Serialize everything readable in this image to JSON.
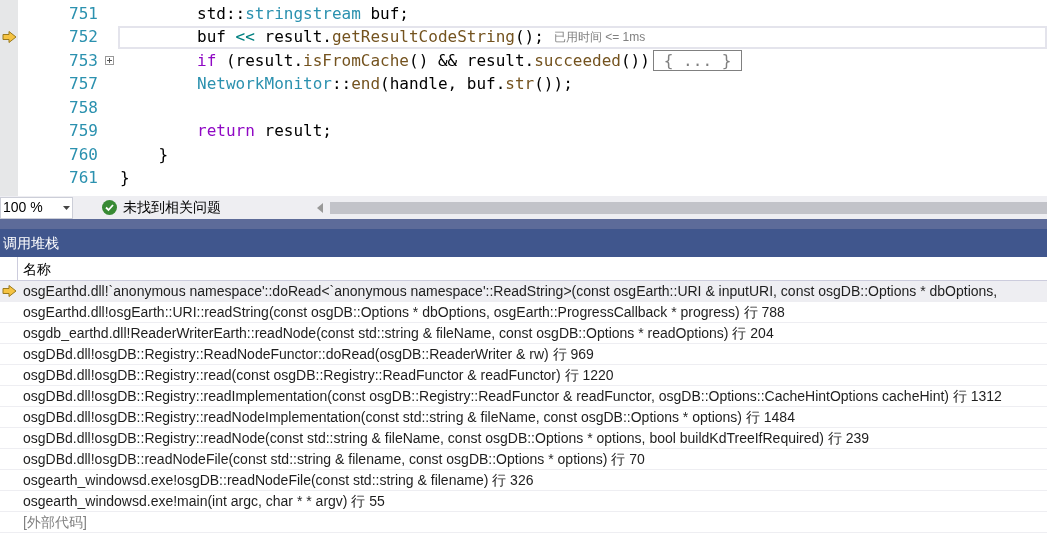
{
  "editor": {
    "lines": [
      {
        "number": "751",
        "current": false,
        "tokens": [
          {
            "kind": "plain",
            "text": "        std::"
          },
          {
            "kind": "type",
            "text": "stringstream"
          },
          {
            "kind": "plain",
            "text": " buf;"
          }
        ]
      },
      {
        "number": "752",
        "current": true,
        "tokens": [
          {
            "kind": "plain",
            "text": "        buf "
          },
          {
            "kind": "op",
            "text": "<<"
          },
          {
            "kind": "plain",
            "text": " result."
          },
          {
            "kind": "func",
            "text": "getResultCodeString"
          },
          {
            "kind": "plain",
            "text": "();"
          }
        ],
        "hint": "已用时间 <= 1ms"
      },
      {
        "number": "753",
        "current": false,
        "collapsed": true,
        "tokens": [
          {
            "kind": "keyword",
            "text": "        if"
          },
          {
            "kind": "plain",
            "text": " (result."
          },
          {
            "kind": "func",
            "text": "isFromCache"
          },
          {
            "kind": "plain",
            "text": "() && result."
          },
          {
            "kind": "func",
            "text": "succeeded"
          },
          {
            "kind": "plain",
            "text": "())"
          }
        ],
        "collapsed_text": "{ ... }"
      },
      {
        "number": "757",
        "current": false,
        "tokens": [
          {
            "kind": "type",
            "text": "        NetworkMonitor"
          },
          {
            "kind": "plain",
            "text": "::"
          },
          {
            "kind": "func",
            "text": "end"
          },
          {
            "kind": "plain",
            "text": "(handle, buf."
          },
          {
            "kind": "func",
            "text": "str"
          },
          {
            "kind": "plain",
            "text": "());"
          }
        ]
      },
      {
        "number": "758",
        "current": false
      },
      {
        "number": "759",
        "current": false,
        "tokens": [
          {
            "kind": "keyword",
            "text": "        return"
          },
          {
            "kind": "plain",
            "text": " result;"
          }
        ]
      },
      {
        "number": "760",
        "current": false,
        "tokens": [
          {
            "kind": "plain",
            "text": "    }"
          }
        ]
      },
      {
        "number": "761",
        "current": false,
        "tokens": [
          {
            "kind": "plain",
            "text": "}"
          }
        ]
      }
    ]
  },
  "status_bar": {
    "zoom": "100 %",
    "issues": "未找到相关问题"
  },
  "call_stack": {
    "title": "调用堆栈",
    "column": "名称",
    "rows": [
      {
        "text": "osgEarthd.dll!`anonymous namespace'::doRead<`anonymous namespace'::ReadString>(const osgEarth::URI & inputURI, const osgDB::Options * dbOptions,",
        "current": true,
        "external": false
      },
      {
        "text": "osgEarthd.dll!osgEarth::URI::readString(const osgDB::Options * dbOptions, osgEarth::ProgressCallback * progress) 行 788",
        "current": false,
        "external": false
      },
      {
        "text": "osgdb_earthd.dll!ReaderWriterEarth::readNode(const std::string & fileName, const osgDB::Options * readOptions) 行 204",
        "current": false,
        "external": false
      },
      {
        "text": "osgDBd.dll!osgDB::Registry::ReadNodeFunctor::doRead(osgDB::ReaderWriter & rw) 行 969",
        "current": false,
        "external": false
      },
      {
        "text": "osgDBd.dll!osgDB::Registry::read(const osgDB::Registry::ReadFunctor & readFunctor) 行 1220",
        "current": false,
        "external": false
      },
      {
        "text": "osgDBd.dll!osgDB::Registry::readImplementation(const osgDB::Registry::ReadFunctor & readFunctor, osgDB::Options::CacheHintOptions cacheHint) 行 1312",
        "current": false,
        "external": false
      },
      {
        "text": "osgDBd.dll!osgDB::Registry::readNodeImplementation(const std::string & fileName, const osgDB::Options * options) 行 1484",
        "current": false,
        "external": false
      },
      {
        "text": "osgDBd.dll!osgDB::Registry::readNode(const std::string & fileName, const osgDB::Options * options, bool buildKdTreeIfRequired) 行 239",
        "current": false,
        "external": false
      },
      {
        "text": "osgDBd.dll!osgDB::readNodeFile(const std::string & filename, const osgDB::Options * options) 行 70",
        "current": false,
        "external": false
      },
      {
        "text": "osgearth_windowsd.exe!osgDB::readNodeFile(const std::string & filename) 行 326",
        "current": false,
        "external": false
      },
      {
        "text": "osgearth_windowsd.exe!main(int argc, char * * argv) 行 55",
        "current": false,
        "external": false
      },
      {
        "text": "[外部代码]",
        "current": false,
        "external": true
      }
    ]
  }
}
